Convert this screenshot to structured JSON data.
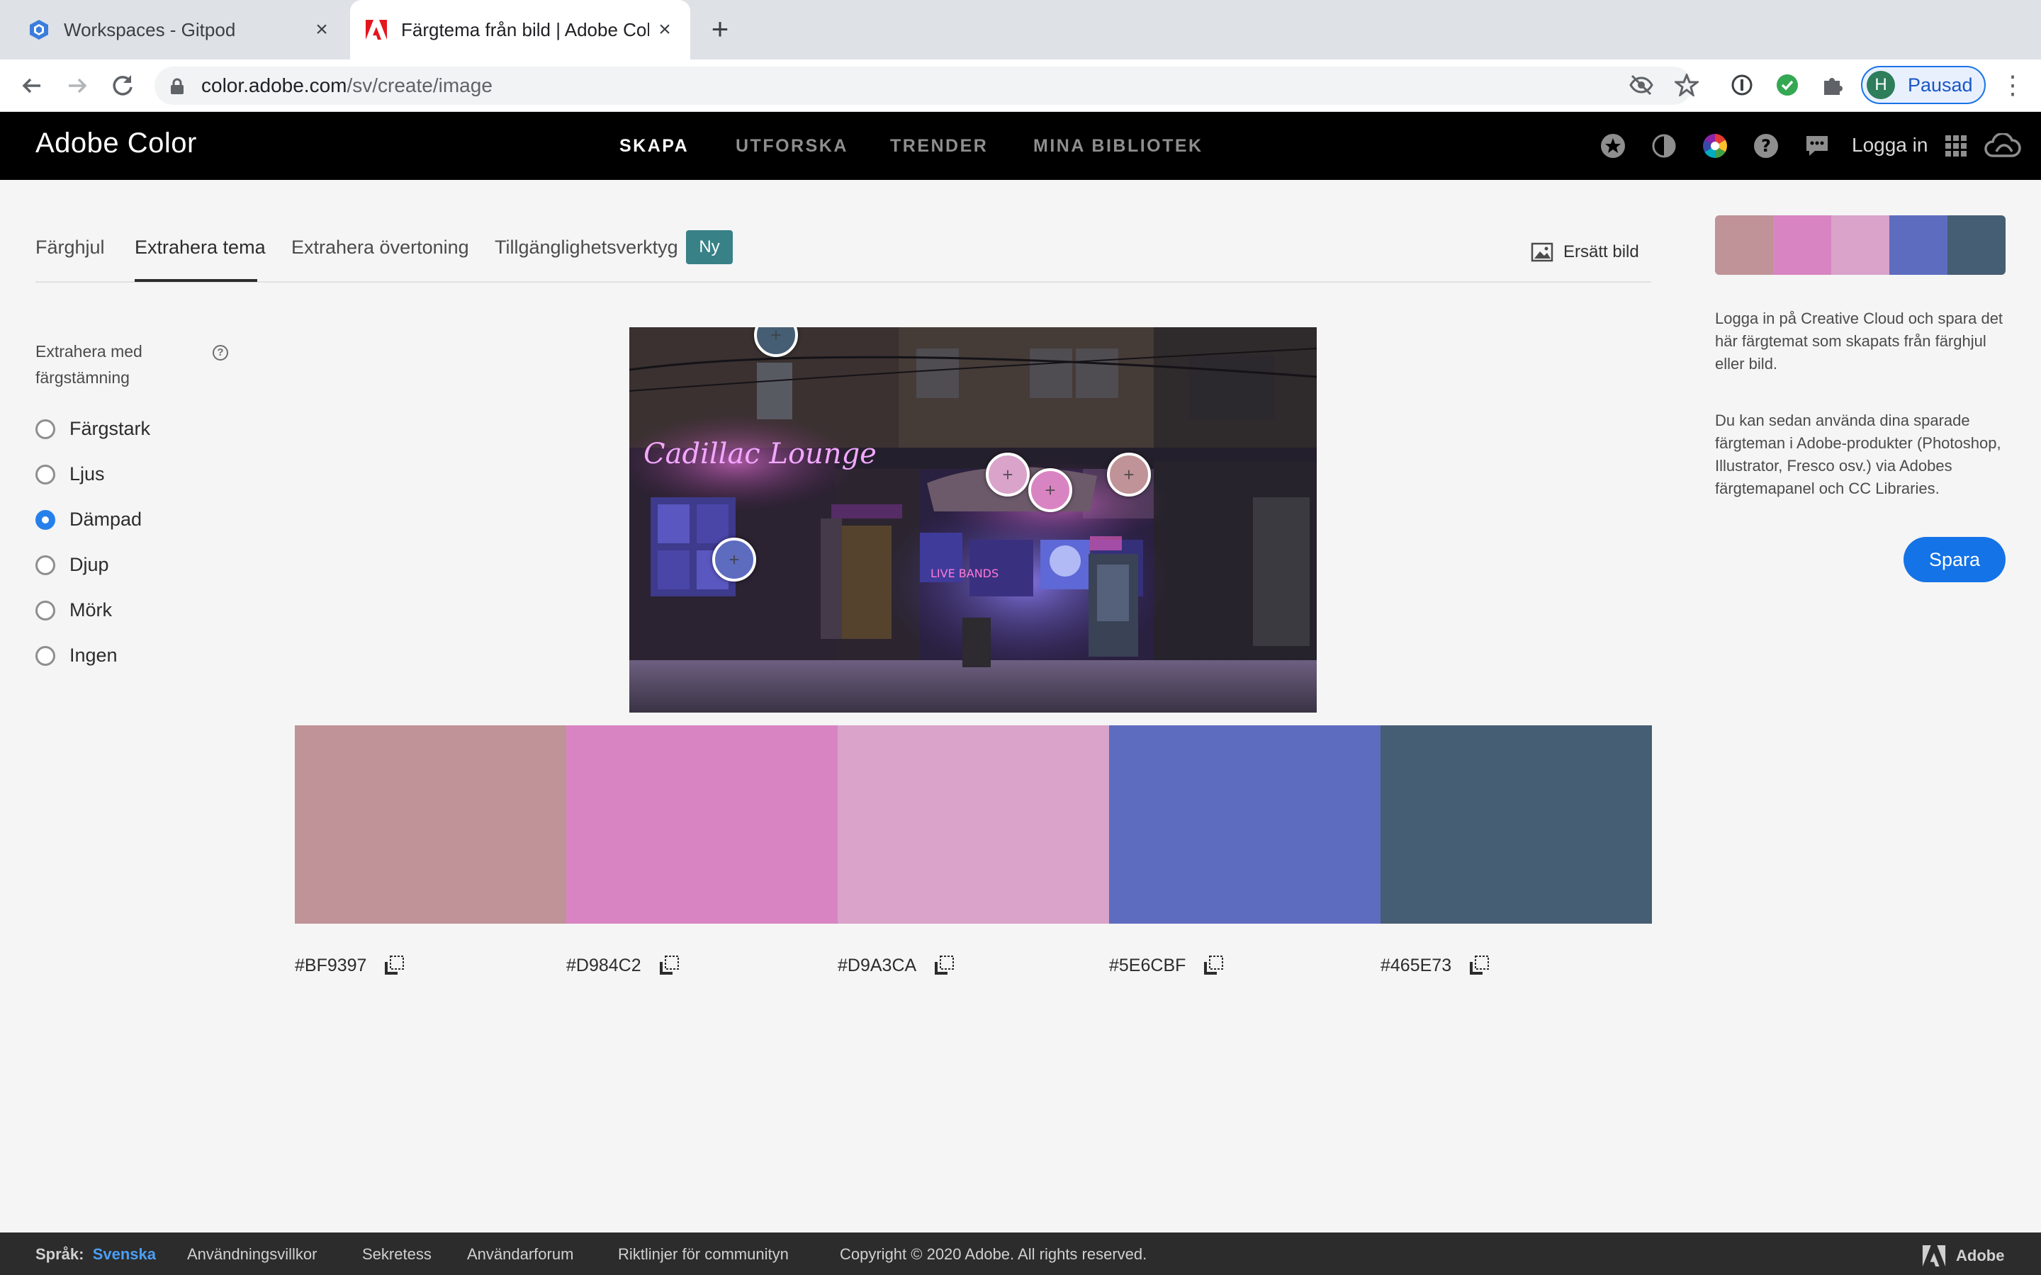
{
  "browser": {
    "tabs": [
      {
        "title": "Workspaces - Gitpod",
        "active": false
      },
      {
        "title": "Färgtema från bild | Adobe Color",
        "active": true
      }
    ],
    "url_host": "color.adobe.com",
    "url_path": "/sv/create/image",
    "profile_initial": "H",
    "profile_label": "Pausad"
  },
  "app": {
    "brand": "Adobe Color",
    "nav": [
      {
        "label": "SKAPA",
        "active": true
      },
      {
        "label": "UTFORSKA",
        "active": false
      },
      {
        "label": "TRENDER",
        "active": false
      },
      {
        "label": "MINA BIBLIOTEK",
        "active": false
      }
    ],
    "login": "Logga in"
  },
  "subtabs": [
    {
      "label": "Färghjul",
      "active": false
    },
    {
      "label": "Extrahera tema",
      "active": true
    },
    {
      "label": "Extrahera övertoning",
      "active": false
    },
    {
      "label": "Tillgänglighetsverktyg",
      "active": false
    }
  ],
  "badge_new": "Ny",
  "replace_image": "Ersätt bild",
  "mood": {
    "label": "Extrahera med färgstämning",
    "options": [
      {
        "label": "Färgstark",
        "selected": false
      },
      {
        "label": "Ljus",
        "selected": false
      },
      {
        "label": "Dämpad",
        "selected": true
      },
      {
        "label": "Djup",
        "selected": false
      },
      {
        "label": "Mörk",
        "selected": false
      },
      {
        "label": "Ingen",
        "selected": false
      }
    ]
  },
  "photo_text": {
    "neon_sign": "Cadillac Lounge",
    "live_sign": "LIVE BANDS"
  },
  "swatches": [
    {
      "hex": "#BF9397",
      "color": "#bf9397"
    },
    {
      "hex": "#D984C2",
      "color": "#d984c2"
    },
    {
      "hex": "#D9A3CA",
      "color": "#d9a3ca"
    },
    {
      "hex": "#5E6CBF",
      "color": "#5e6cbf"
    },
    {
      "hex": "#465E73",
      "color": "#465e73"
    }
  ],
  "side": {
    "text1": "Logga in på Creative Cloud och spara det här färgtemat som skapats från färghjul eller bild.",
    "text2": "Du kan sedan använda dina sparade färgteman i Adobe-produkter (Photoshop, Illustrator, Fresco osv.) via Adobes färgtemapanel och CC Libraries.",
    "save": "Spara"
  },
  "footer": {
    "lang_label": "Språk:",
    "lang_value": "Svenska",
    "links": [
      "Användningsvillkor",
      "Sekretess",
      "Användarforum",
      "Riktlinjer för communityn"
    ],
    "copyright": "Copyright © 2020 Adobe. All rights reserved.",
    "adobe": "Adobe"
  }
}
